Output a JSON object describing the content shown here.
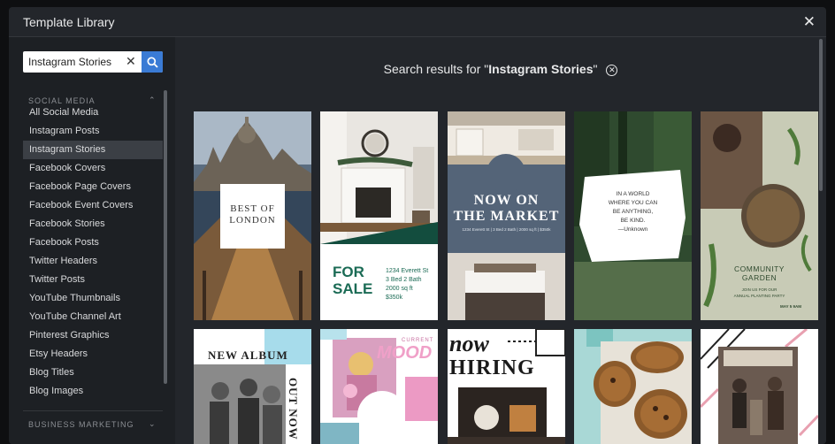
{
  "window": {
    "title": "Template Library"
  },
  "search": {
    "value": "Instagram Stories"
  },
  "sidebar": {
    "section1": "SOCIAL MEDIA",
    "items": [
      {
        "label": "All Social Media"
      },
      {
        "label": "Instagram Posts"
      },
      {
        "label": "Instagram Stories"
      },
      {
        "label": "Facebook Covers"
      },
      {
        "label": "Facebook Page Covers"
      },
      {
        "label": "Facebook Event Covers"
      },
      {
        "label": "Facebook Stories"
      },
      {
        "label": "Facebook Posts"
      },
      {
        "label": "Twitter Headers"
      },
      {
        "label": "Twitter Posts"
      },
      {
        "label": "YouTube Thumbnails"
      },
      {
        "label": "YouTube Channel Art"
      },
      {
        "label": "Pinterest Graphics"
      },
      {
        "label": "Etsy Headers"
      },
      {
        "label": "Blog Titles"
      },
      {
        "label": "Blog Images"
      }
    ],
    "section2": "BUSINESS MARKETING"
  },
  "results": {
    "prefix": "Search results for \"",
    "query": "Instagram Stories",
    "suffix": "\""
  },
  "templates": [
    {
      "lines": [
        "BEST OF",
        "LONDON"
      ]
    },
    {
      "lines": [
        "FOR",
        "SALE",
        "1234 Everett St",
        "3 Bed 2 Bath",
        "2000 sq ft",
        "$350k"
      ]
    },
    {
      "lines": [
        "NOW ON",
        "THE MARKET",
        "1234 Everett St | 3 Bed 2 Bath | 2000 sq ft | $350k"
      ]
    },
    {
      "lines": [
        "IN A WORLD",
        "WHERE YOU CAN",
        "BE ANYTHING,",
        "BE KIND.",
        "—Unknown"
      ]
    },
    {
      "lines": [
        "COMMUNITY",
        "GARDEN",
        "JOIN US FOR OUR",
        "ANNUAL PLANTING PARTY",
        "MAY 5 9AM"
      ]
    },
    {
      "lines": [
        "NEW ALBUM",
        "OUT NOW"
      ]
    },
    {
      "lines": [
        "CURRENT",
        "MOOD"
      ]
    },
    {
      "lines": [
        "now",
        "HIRING"
      ]
    },
    {
      "lines": []
    },
    {
      "lines": []
    }
  ]
}
